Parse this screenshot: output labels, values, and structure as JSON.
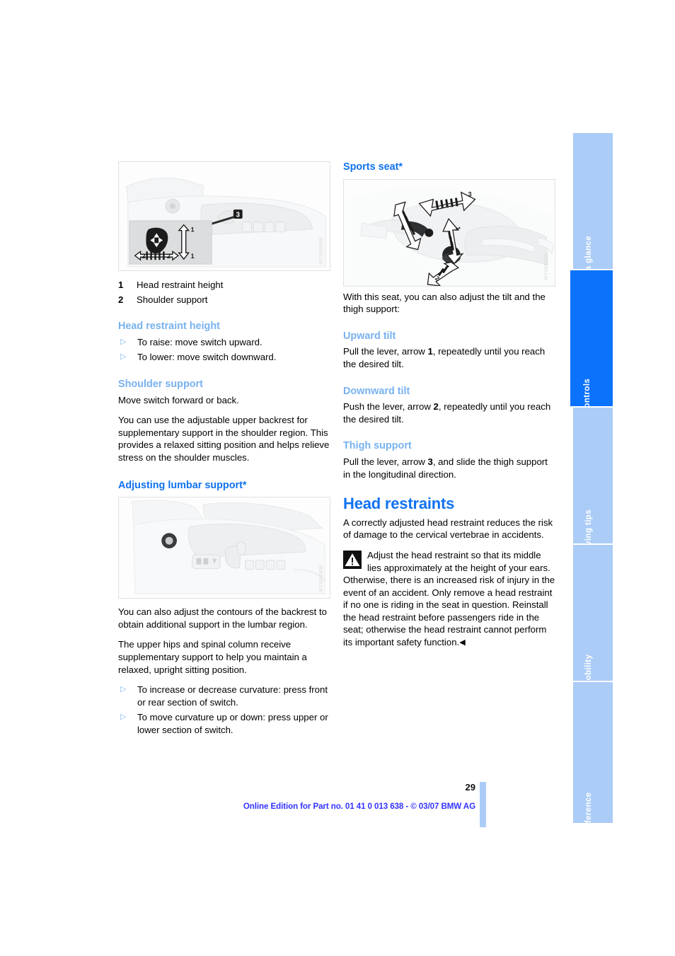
{
  "document": {
    "page_number": "29",
    "footer_note": "Online Edition for Part no. 01 41 0 013 638 - © 03/07 BMW AG"
  },
  "index_tabs": [
    {
      "label": "At a glance",
      "active": false
    },
    {
      "label": "Controls",
      "active": true
    },
    {
      "label": "Driving tips",
      "active": false
    },
    {
      "label": "Mobility",
      "active": false
    },
    {
      "label": "Reference",
      "active": false
    }
  ],
  "colors": {
    "heading_strong": "#1072F0",
    "heading_light": "#77B2EF",
    "tab_active": "#0B72FB",
    "tab_inactive": "#ABCCF6",
    "footer_text": "#3333FF",
    "bullet": "#7FB4ED"
  },
  "left_column": {
    "figure_seat_switch": {
      "name": "seat-switch-illustration",
      "watermark": "MY08BMW"
    },
    "legend": [
      {
        "num": "1",
        "text": "Head restraint height"
      },
      {
        "num": "2",
        "text": "Shoulder support"
      }
    ],
    "head_restraint_height": {
      "heading": "Head restraint height",
      "bullets": [
        "To raise: move switch upward.",
        "To lower: move switch downward."
      ]
    },
    "shoulder_support": {
      "heading": "Shoulder support",
      "paragraphs": [
        "Move switch forward or back.",
        "You can use the adjustable upper backrest for supplementary support in the shoulder region. This provides a relaxed sitting position and helps relieve stress on the shoulder muscles."
      ]
    },
    "lumbar_support": {
      "heading": "Adjusting lumbar support*",
      "figure": {
        "name": "lumbar-support-illustration",
        "watermark": "MY08BMW"
      },
      "paragraphs": [
        "You can also adjust the contours of the backrest to obtain additional support in the lumbar region.",
        "The upper hips and spinal column receive supplementary support to help you maintain a relaxed, upright sitting position."
      ],
      "bullets": [
        "To increase or decrease curvature: press front or rear section of switch.",
        "To move curvature up or down: press upper or lower section of switch."
      ]
    }
  },
  "right_column": {
    "sports_seat": {
      "heading": "Sports seat*",
      "figure": {
        "name": "sports-seat-illustration",
        "watermark": "MY08BMW"
      },
      "intro": "With this seat, you can also adjust the tilt and the thigh support:",
      "upward_tilt": {
        "heading": "Upward tilt",
        "text_before": "Pull the lever, arrow ",
        "arrow": "1",
        "text_after": ", repeatedly until you reach the desired tilt."
      },
      "downward_tilt": {
        "heading": "Downward tilt",
        "text_before": "Push the lever, arrow ",
        "arrow": "2",
        "text_after": ", repeatedly until you reach the desired tilt."
      },
      "thigh_support": {
        "heading": "Thigh support",
        "text_before": "Pull the lever, arrow ",
        "arrow": "3",
        "text_after": ", and slide the thigh support in the longitudinal direction."
      }
    },
    "head_restraints": {
      "heading": "Head restraints",
      "intro": "A correctly adjusted head restraint reduces the risk of damage to the cervical vertebrae in accidents.",
      "warning": {
        "icon": "warning-triangle-icon",
        "text": "Adjust the head restraint so that its middle lies approximately at the height of your ears. Otherwise, there is an increased risk of injury in the event of an accident. Only remove a head restraint if no one is riding in the seat in question. Reinstall the head restraint before passengers ride in the seat; otherwise the head restraint cannot perform its important safety function.",
        "end_marker": "◀"
      }
    }
  }
}
